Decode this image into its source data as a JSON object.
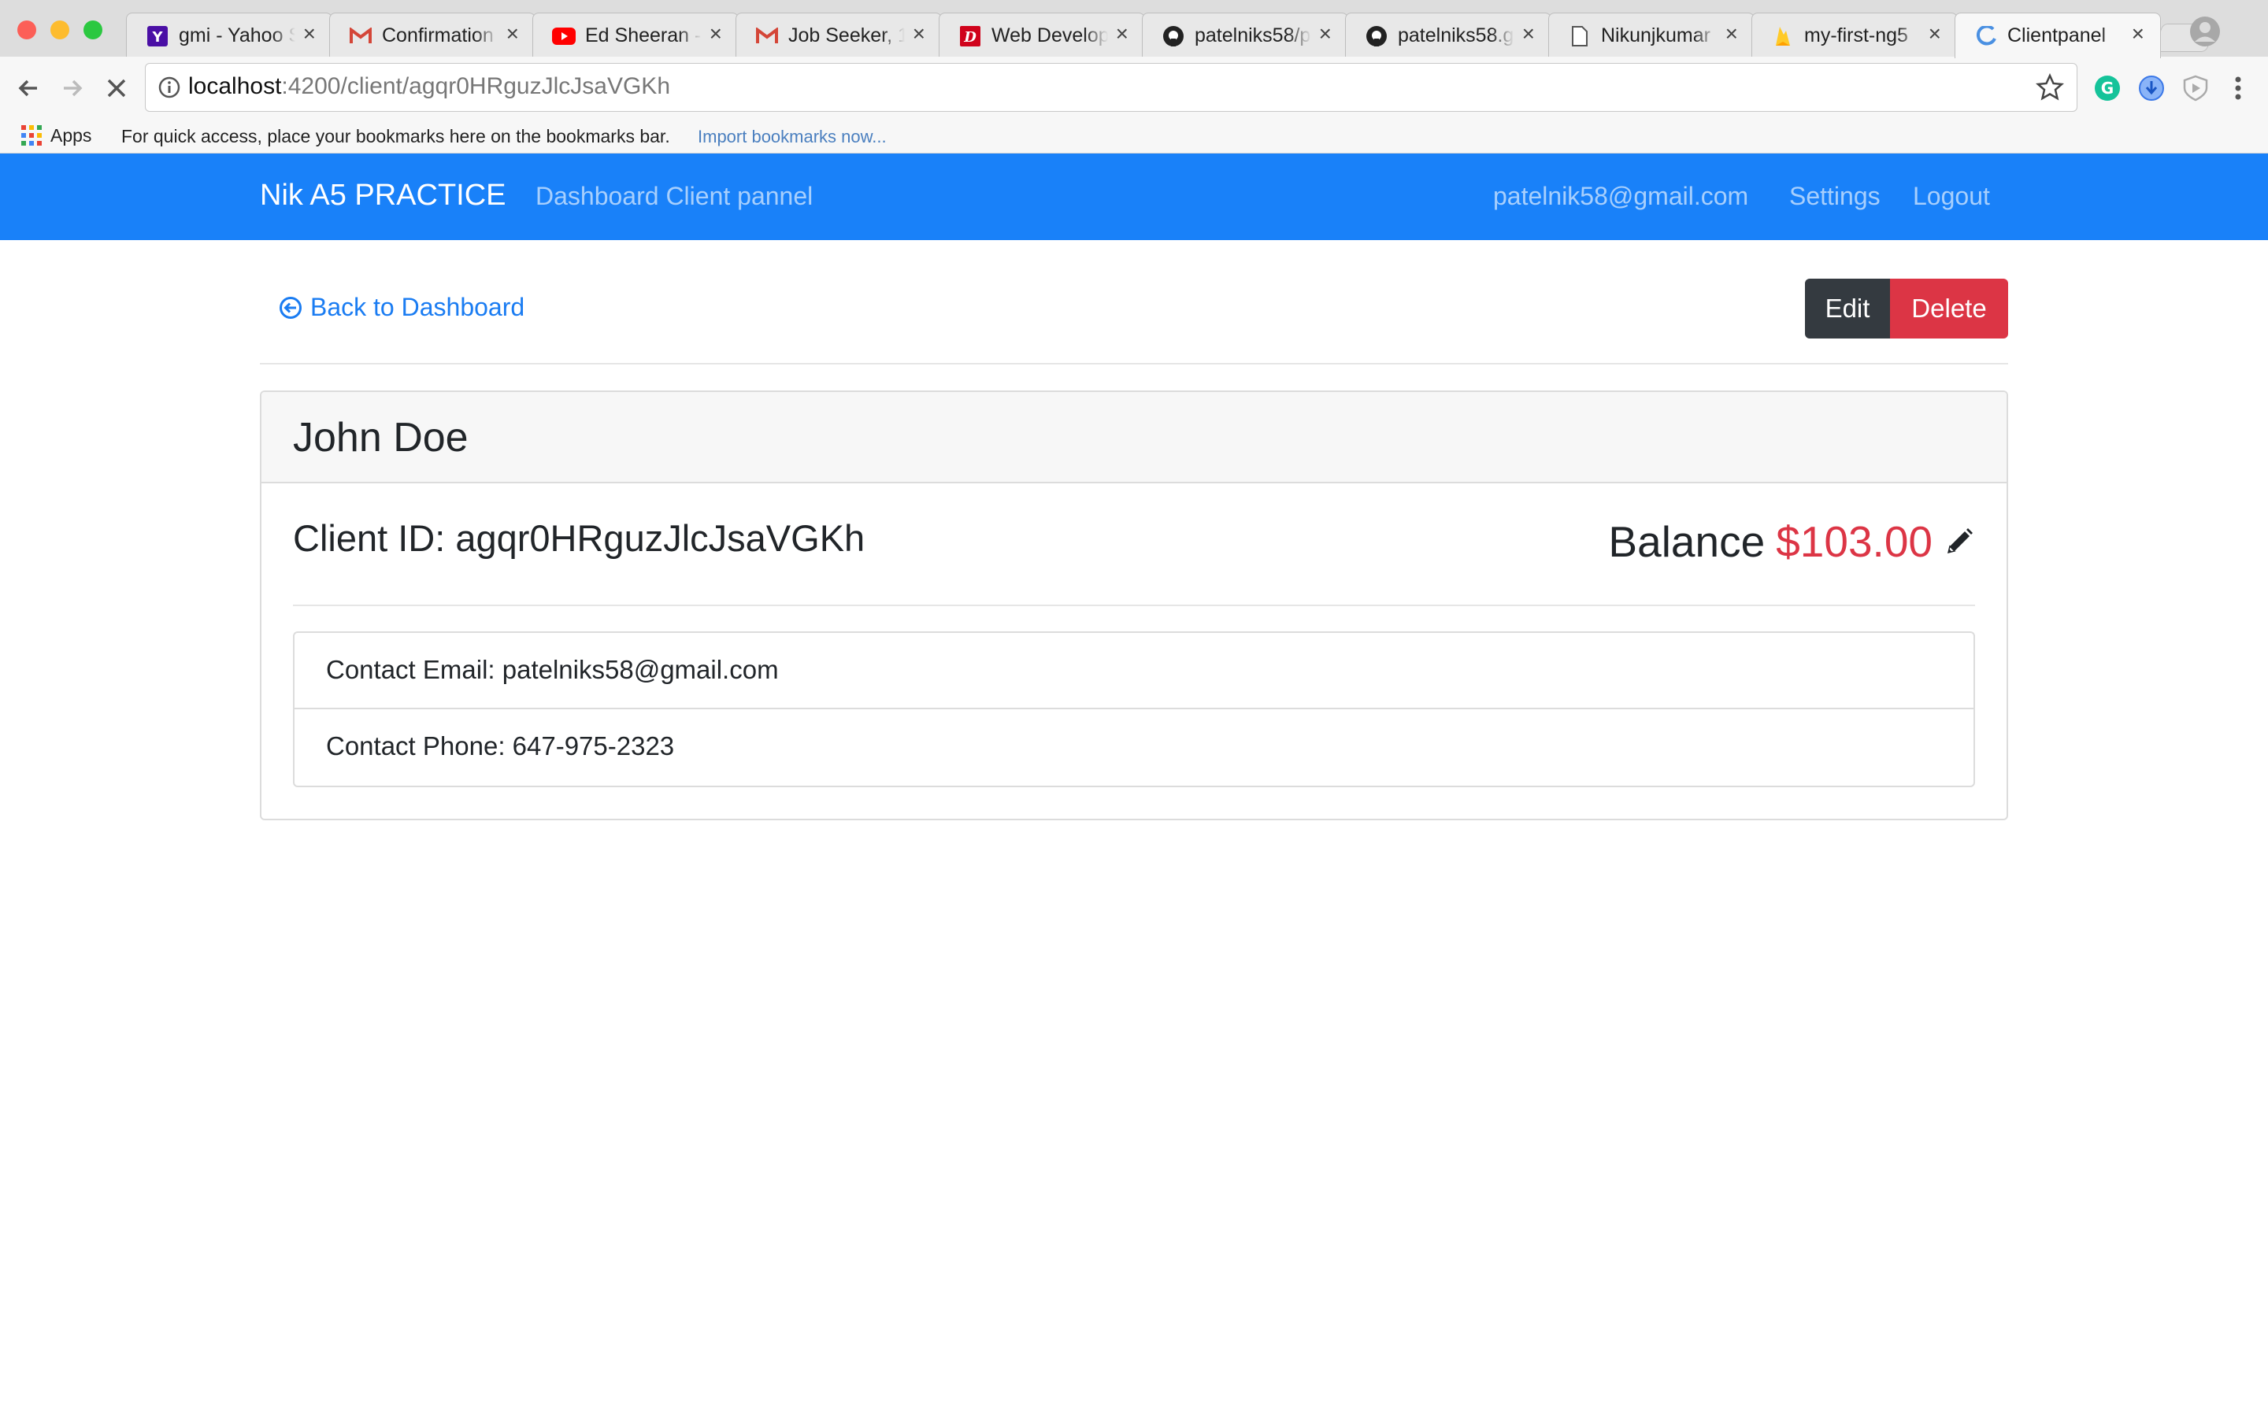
{
  "browser": {
    "tabs": [
      {
        "title": "gmi - Yahoo Search",
        "icon": "yahoo-icon"
      },
      {
        "title": "Confirmation",
        "icon": "gmail-icon"
      },
      {
        "title": "Ed Sheeran - ",
        "icon": "youtube-icon"
      },
      {
        "title": "Job Seeker, 1",
        "icon": "gmail-icon"
      },
      {
        "title": "Web Develop",
        "icon": "d-logo-icon"
      },
      {
        "title": "patelniks58/p",
        "icon": "github-icon"
      },
      {
        "title": "patelniks58.g",
        "icon": "github-icon"
      },
      {
        "title": "Nikunjkumar",
        "icon": "document-icon"
      },
      {
        "title": "my-first-ng5",
        "icon": "firebase-icon"
      },
      {
        "title": "Clientpanel",
        "icon": "loading-icon"
      }
    ],
    "url_host": "localhost",
    "url_path": ":4200/client/agqr0HRguzJlcJsaVGKh",
    "bookmarks": {
      "apps_label": "Apps",
      "hint": "For quick access, place your bookmarks here on the bookmarks bar.",
      "import_link": "Import bookmarks now..."
    }
  },
  "navbar": {
    "brand": "Nik A5 PRACTICE",
    "left_link": "Dashboard Client pannel",
    "user_email": "patelnik58@gmail.com",
    "settings": "Settings",
    "logout": "Logout"
  },
  "actions": {
    "back": "Back to Dashboard",
    "edit": "Edit",
    "delete": "Delete"
  },
  "client": {
    "name": "John Doe",
    "id_label": "Client ID: agqr0HRguzJlcJsaVGKh",
    "balance_label": "Balance",
    "balance_value": "$103.00",
    "email_line": "Contact Email: patelniks58@gmail.com",
    "phone_line": "Contact Phone: 647-975-2323"
  },
  "colors": {
    "navbar": "#1981f9",
    "link": "#1a7cf2",
    "danger": "#dc3545",
    "dark": "#343a40"
  }
}
